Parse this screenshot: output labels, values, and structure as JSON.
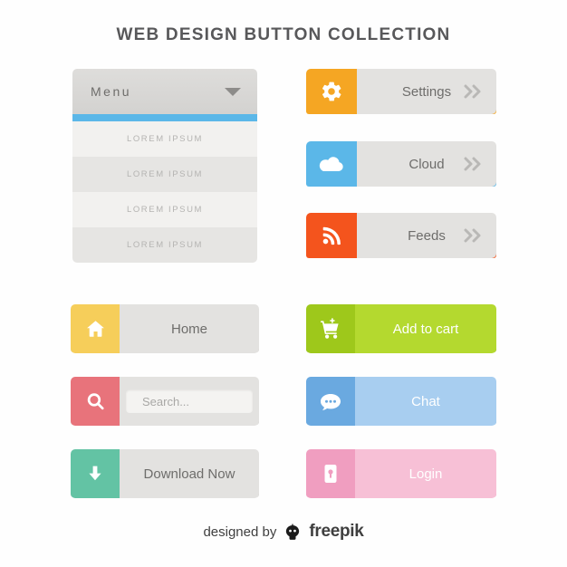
{
  "title": "WEB DESIGN BUTTON COLLECTION",
  "menu": {
    "label": "Menu",
    "accent": "#5bb7e8",
    "items": [
      {
        "label": "LOREM IPSUM"
      },
      {
        "label": "LOREM IPSUM"
      },
      {
        "label": "LOREM IPSUM"
      },
      {
        "label": "LOREM IPSUM"
      }
    ]
  },
  "right_stack": [
    {
      "label": "Settings",
      "icon": "gear-icon",
      "icon_bg": "#f5a623",
      "body_bg": "#e3e2e0",
      "under": "#f5a623",
      "text_color": "#6e6d6b",
      "chev_color": "#b9b8b6"
    },
    {
      "label": "Cloud",
      "icon": "cloud-icon",
      "icon_bg": "#5bb7e8",
      "body_bg": "#e3e2e0",
      "under": "#5bb7e8",
      "text_color": "#6e6d6b",
      "chev_color": "#b9b8b6"
    },
    {
      "label": "Feeds",
      "icon": "rss-icon",
      "icon_bg": "#f4541d",
      "body_bg": "#e3e2e0",
      "under": "#f4541d",
      "text_color": "#6e6d6b",
      "chev_color": "#b9b8b6"
    }
  ],
  "left_buttons": [
    {
      "label": "Home",
      "icon": "home-icon",
      "icon_bg": "#f6ce5a",
      "body_bg": "#e3e2e0",
      "text_color": "#6e6d6b"
    },
    {
      "label": "Search...",
      "icon": "magnifier-icon",
      "icon_bg": "#e8737b",
      "body_bg": "#e3e2e0",
      "text_color": "#a9a8a6",
      "is_search": "yes"
    },
    {
      "label": "Download Now",
      "icon": "download-arrow-icon",
      "icon_bg": "#63c3a4",
      "body_bg": "#e3e2e0",
      "text_color": "#6e6d6b"
    }
  ],
  "right_buttons": [
    {
      "label": "Add to cart",
      "icon": "shopping-cart-icon",
      "icon_bg": "#9ec81b",
      "body_bg": "#b4d92f",
      "text_color": "#ffffff",
      "under": "#8ab016"
    },
    {
      "label": "Chat",
      "icon": "chat-bubble-icon",
      "icon_bg": "#6aa9e0",
      "body_bg": "#a8cef0",
      "text_color": "#ffffff",
      "under": "#8fbfe8"
    },
    {
      "label": "Login",
      "icon": "lock-icon",
      "icon_bg": "#f09ec0",
      "body_bg": "#f7c0d6",
      "text_color": "#ffffff",
      "under": "#eeabc9"
    }
  ],
  "footer": {
    "prefix": "designed by",
    "brand": "freepik",
    "mark_icon": "freepik-logo-icon"
  }
}
